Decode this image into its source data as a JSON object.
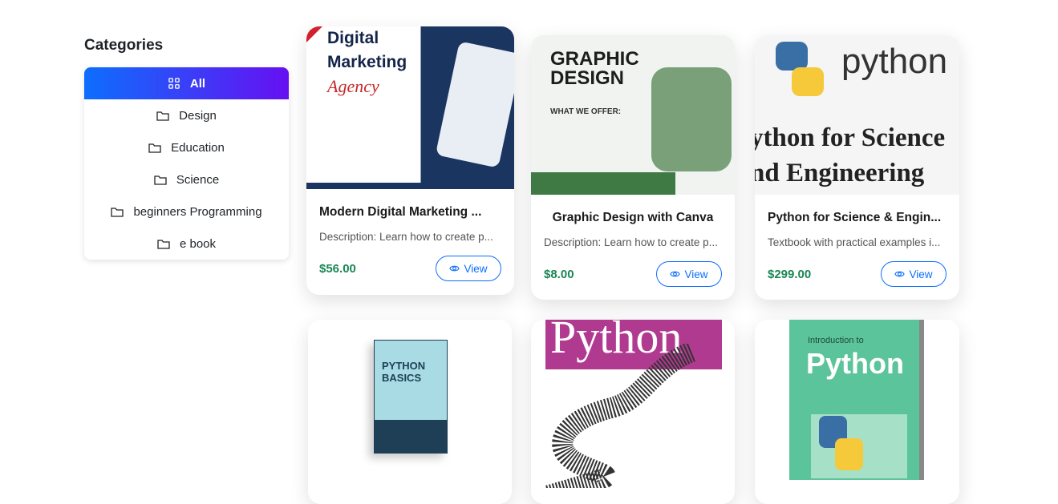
{
  "sidebar": {
    "title": "Categories",
    "items": [
      {
        "label": "All",
        "icon": "grid-icon",
        "active": true
      },
      {
        "label": "Design",
        "icon": "folder-icon"
      },
      {
        "label": "Education",
        "icon": "folder-icon"
      },
      {
        "label": "Science",
        "icon": "folder-icon"
      },
      {
        "label": "beginners Programming",
        "icon": "folder-icon"
      },
      {
        "label": "e book",
        "icon": "folder-icon"
      }
    ]
  },
  "accent": {
    "primary": "#0d6efd",
    "secondary": "#6610f2",
    "price": "#198754"
  },
  "products": [
    {
      "title": "Modern Digital Marketing ...",
      "description": "Description: Learn how to create p...",
      "price": "$56.00",
      "view_label": "View",
      "image_text": "Digital Marketing",
      "image_sub": "Agency"
    },
    {
      "title": "Graphic Design with Canva",
      "description": "Description: Learn how to create p...",
      "price": "$8.00",
      "view_label": "View",
      "image_text": "GRAPHIC DESIGN",
      "image_sub": "WHAT WE OFFER:"
    },
    {
      "title": "Python for Science & Engin...",
      "description": "Textbook with practical examples i...",
      "price": "$299.00",
      "view_label": "View",
      "image_text": "python",
      "image_sub": "ython for Science nd Engineering"
    },
    {
      "image_text": "PYTHON BASICS"
    },
    {
      "image_text": "Python"
    },
    {
      "image_text": "Python",
      "image_sub": "Introduction to"
    }
  ]
}
